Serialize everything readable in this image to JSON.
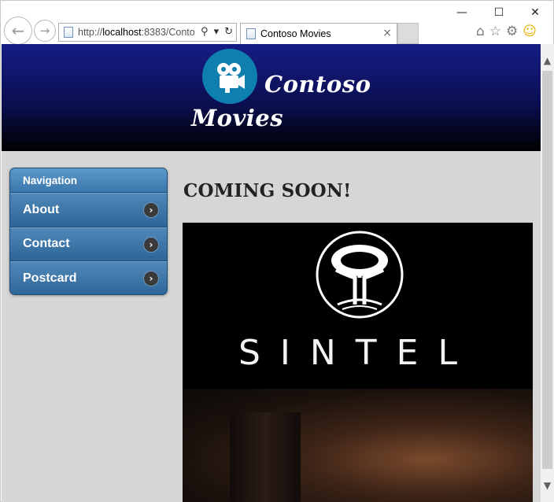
{
  "browser": {
    "window_controls": {
      "minimize": "—",
      "maximize": "☐",
      "close": "✕"
    },
    "nav": {
      "back_icon": "←",
      "forward_icon": "→"
    },
    "address": {
      "url_prefix": "http://",
      "url_host": "localhost",
      "url_rest": ":8383/Conto"
    },
    "tab": {
      "title": "Contoso Movies",
      "close": "×"
    },
    "icons": [
      "home-icon",
      "star-icon",
      "gear-icon",
      "smiley-icon"
    ]
  },
  "site": {
    "brand_line1": "Contoso",
    "brand_line2": "Movies"
  },
  "navigation": {
    "heading": "Navigation",
    "items": [
      {
        "label": "About"
      },
      {
        "label": "Contact"
      },
      {
        "label": "Postcard"
      }
    ]
  },
  "main": {
    "heading": "COMING SOON!",
    "poster_title": "SINTEL"
  },
  "colors": {
    "header_top": "#161d86",
    "header_bottom": "#000000",
    "logo": "#0e7fae",
    "nav_blue": "#2f6798",
    "page_bg": "#d6d6d6"
  }
}
